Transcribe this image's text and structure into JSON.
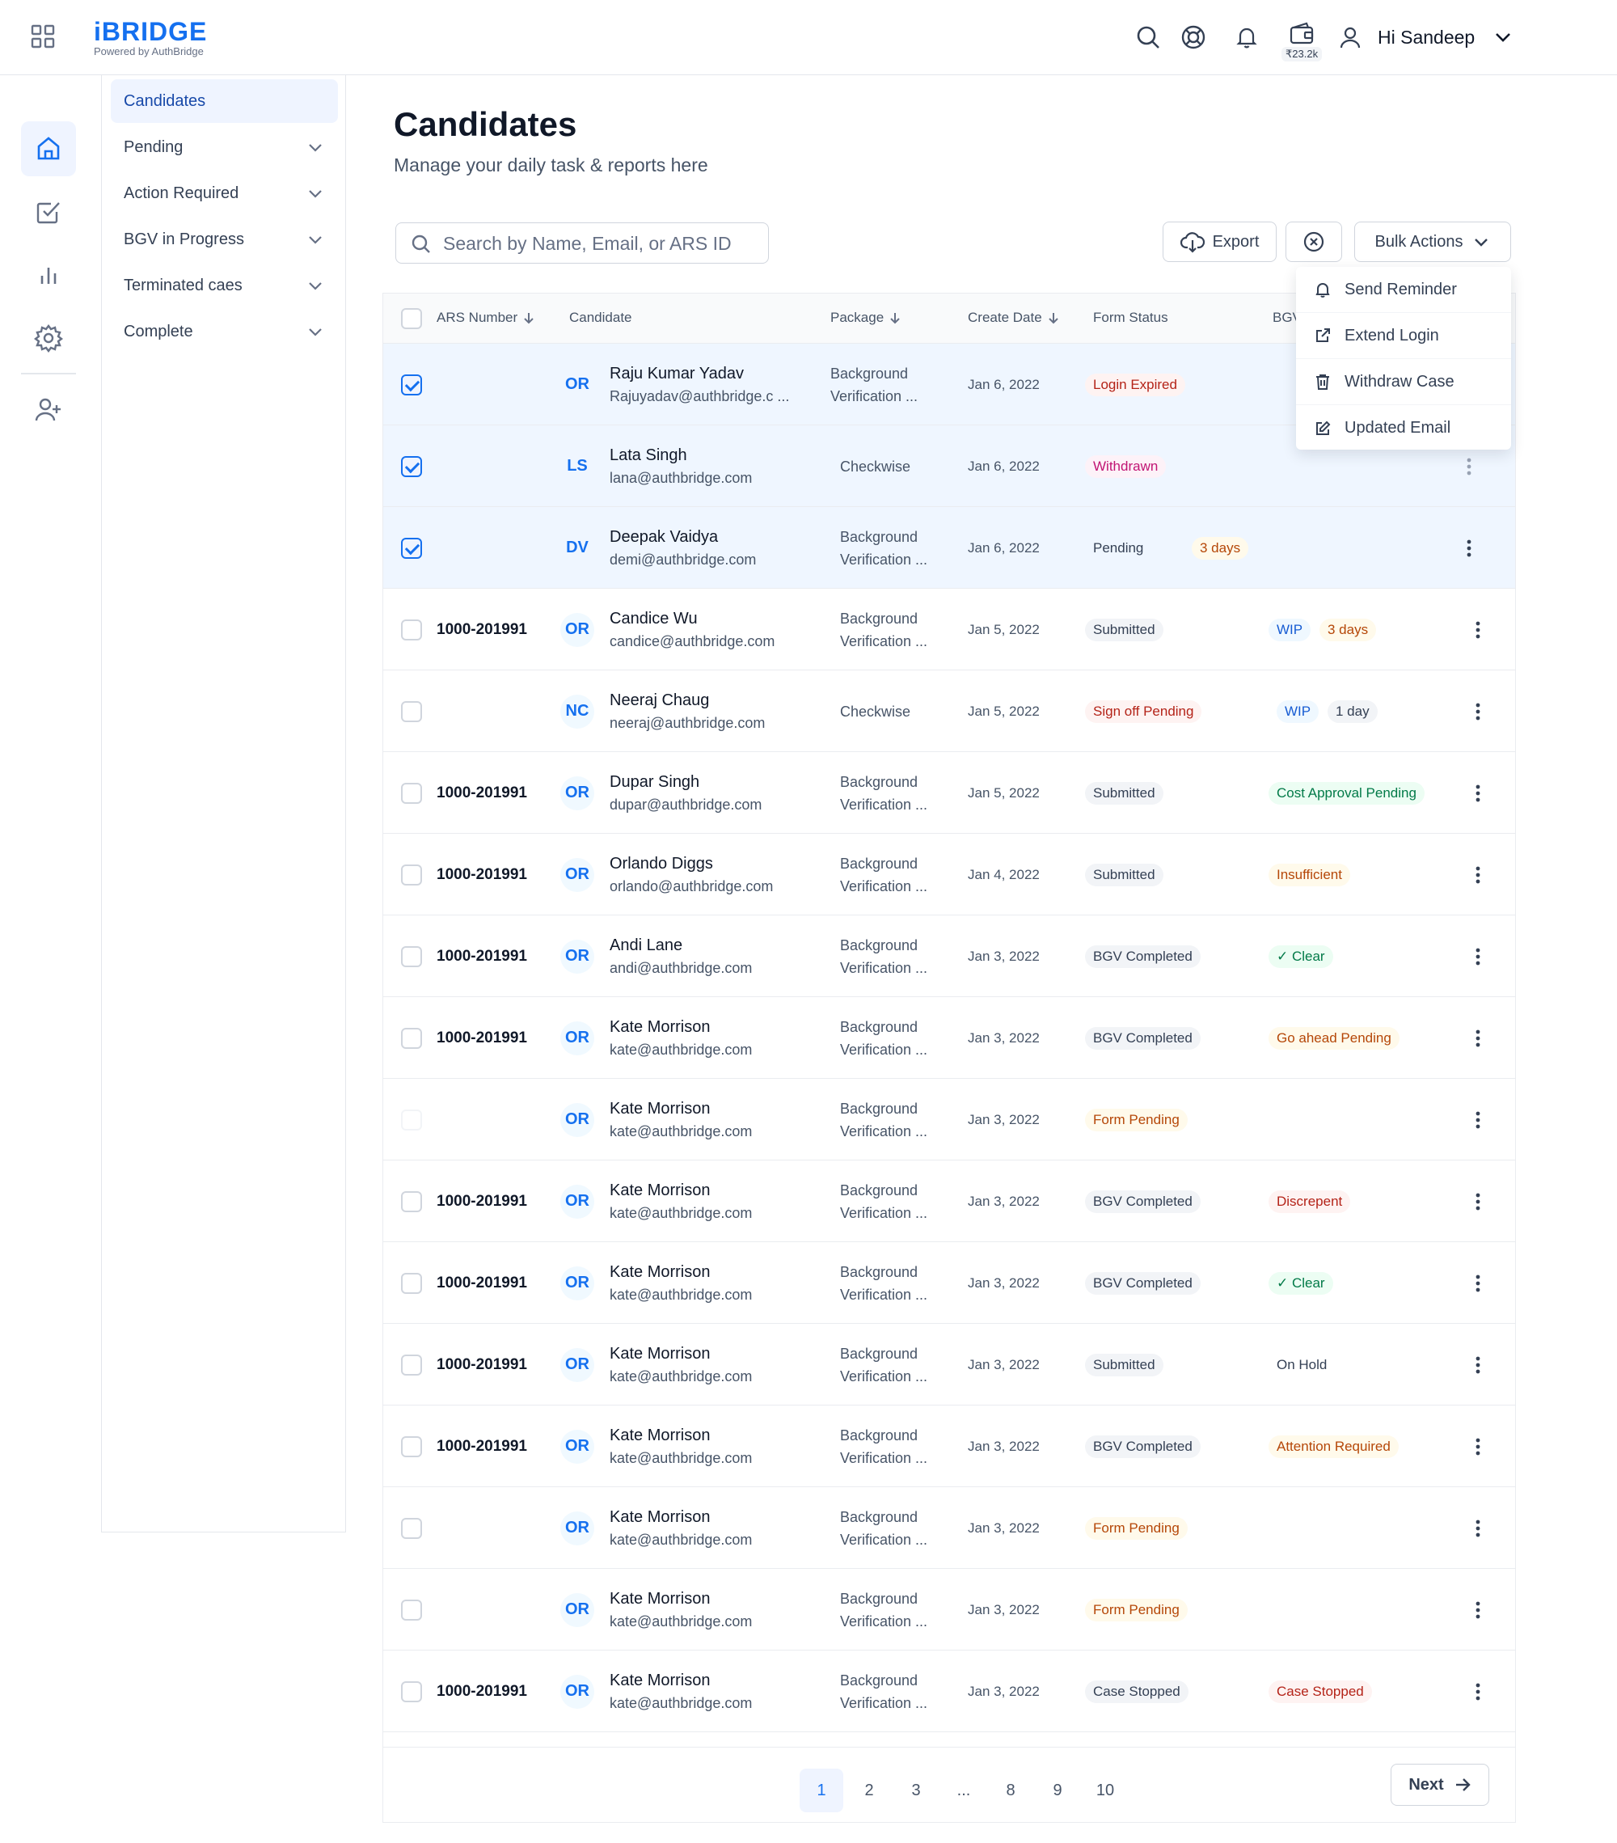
{
  "app": {
    "brand": "iBRIDGE",
    "brand_sub": "Powered by AuthBridge",
    "wallet_balance": "₹23.2k",
    "greeting": "Hi Sandeep"
  },
  "subnav": {
    "items": [
      {
        "label": "Candidates",
        "active": true,
        "expandable": false
      },
      {
        "label": "Pending",
        "active": false,
        "expandable": true
      },
      {
        "label": "Action Required",
        "active": false,
        "expandable": true
      },
      {
        "label": "BGV in Progress",
        "active": false,
        "expandable": true
      },
      {
        "label": "Terminated caes",
        "active": false,
        "expandable": true
      },
      {
        "label": "Complete",
        "active": false,
        "expandable": true
      }
    ]
  },
  "header": {
    "title": "Candidates",
    "subtitle": "Manage your daily task & reports here"
  },
  "toolbar": {
    "search_placeholder": "Search by Name, Email, or ARS ID",
    "export_label": "Export",
    "bulk_label": "Bulk Actions"
  },
  "bulk_menu": {
    "items": [
      {
        "label": "Send Reminder",
        "icon": "bell-icon"
      },
      {
        "label": "Extend Login",
        "icon": "external-link-icon"
      },
      {
        "label": "Withdraw Case",
        "icon": "trash-icon"
      },
      {
        "label": "Updated Email",
        "icon": "edit-icon"
      }
    ]
  },
  "table": {
    "columns": {
      "ars": "ARS Number",
      "candidate": "Candidate",
      "package": "Package",
      "create_date": "Create Date",
      "form_status": "Form Status",
      "bgv": "BGV"
    },
    "rows": [
      {
        "checked": true,
        "ars": "",
        "initials": "OR",
        "name": "Raju Kumar Yadav",
        "email": "Rajuyadav@authbridge.c ...",
        "package": [
          "Background",
          "Verification ..."
        ],
        "date": "Jan 6, 2022",
        "form": "Login Expired",
        "form_tone": "red",
        "form_extra": "",
        "bgv": "",
        "bgv_tone": "",
        "bgv_extra": ""
      },
      {
        "checked": true,
        "ars": "",
        "initials": "LS",
        "name": "Lata Singh",
        "email": "lana@authbridge.com",
        "package": [
          "Checkwise"
        ],
        "date": "Jan 6, 2022",
        "form": "Withdrawn",
        "form_tone": "pink",
        "form_extra": "",
        "bgv": "",
        "bgv_tone": "",
        "bgv_extra": ""
      },
      {
        "checked": true,
        "ars": "",
        "initials": "DV",
        "name": "Deepak Vaidya",
        "email": "demi@authbridge.com",
        "package": [
          "Background",
          "Verification ..."
        ],
        "date": "Jan 6, 2022",
        "form": "Pending",
        "form_tone": "plain",
        "form_extra": "3 days",
        "bgv": "",
        "bgv_tone": "",
        "bgv_extra": ""
      },
      {
        "checked": false,
        "ars": "1000-201991",
        "initials": "OR",
        "name": "Candice Wu",
        "email": "candice@authbridge.com",
        "package": [
          "Background",
          "Verification ..."
        ],
        "date": "Jan 5, 2022",
        "form": "Submitted",
        "form_tone": "gray",
        "form_extra": "",
        "bgv": "WIP",
        "bgv_tone": "blue",
        "bgv_extra": "3 days"
      },
      {
        "checked": false,
        "ars": "",
        "initials": "NC",
        "name": "Neeraj Chaug",
        "email": "neeraj@authbridge.com",
        "package": [
          "Checkwise"
        ],
        "date": "Jan 5, 2022",
        "form": "Sign off Pending",
        "form_tone": "red",
        "form_extra": "",
        "bgv": "WIP",
        "bgv_tone": "blue",
        "bgv_extra": "1 day"
      },
      {
        "checked": false,
        "ars": "1000-201991",
        "initials": "OR",
        "name": "Dupar Singh",
        "email": "dupar@authbridge.com",
        "package": [
          "Background",
          "Verification ..."
        ],
        "date": "Jan 5, 2022",
        "form": "Submitted",
        "form_tone": "gray",
        "form_extra": "",
        "bgv": "Cost Approval Pending",
        "bgv_tone": "green",
        "bgv_extra": ""
      },
      {
        "checked": false,
        "ars": "1000-201991",
        "initials": "OR",
        "name": "Orlando Diggs",
        "email": "orlando@authbridge.com",
        "package": [
          "Background",
          "Verification ..."
        ],
        "date": "Jan 4, 2022",
        "form": "Submitted",
        "form_tone": "gray",
        "form_extra": "",
        "bgv": "Insufficient",
        "bgv_tone": "orange",
        "bgv_extra": ""
      },
      {
        "checked": false,
        "ars": "1000-201991",
        "initials": "OR",
        "name": "Andi Lane",
        "email": "andi@authbridge.com",
        "package": [
          "Background",
          "Verification ..."
        ],
        "date": "Jan 3, 2022",
        "form": "BGV Completed",
        "form_tone": "gray",
        "form_extra": "",
        "bgv": "✓ Clear",
        "bgv_tone": "green",
        "bgv_extra": ""
      },
      {
        "checked": false,
        "ars": "1000-201991",
        "initials": "OR",
        "name": "Kate Morrison",
        "email": "kate@authbridge.com",
        "package": [
          "Background",
          "Verification ..."
        ],
        "date": "Jan 3, 2022",
        "form": "BGV Completed",
        "form_tone": "gray",
        "form_extra": "",
        "bgv": "Go ahead Pending",
        "bgv_tone": "orange",
        "bgv_extra": ""
      },
      {
        "checked": false,
        "disabled": true,
        "ars": "",
        "initials": "OR",
        "name": "Kate Morrison",
        "email": "kate@authbridge.com",
        "package": [
          "Background",
          "Verification ..."
        ],
        "date": "Jan 3, 2022",
        "form": "Form Pending",
        "form_tone": "orange",
        "form_extra": "",
        "bgv": "",
        "bgv_tone": "",
        "bgv_extra": ""
      },
      {
        "checked": false,
        "ars": "1000-201991",
        "initials": "OR",
        "name": "Kate Morrison",
        "email": "kate@authbridge.com",
        "package": [
          "Background",
          "Verification ..."
        ],
        "date": "Jan 3, 2022",
        "form": "BGV Completed",
        "form_tone": "gray",
        "form_extra": "",
        "bgv": "Discrepent",
        "bgv_tone": "red",
        "bgv_extra": ""
      },
      {
        "checked": false,
        "ars": "1000-201991",
        "initials": "OR",
        "name": "Kate Morrison",
        "email": "kate@authbridge.com",
        "package": [
          "Background",
          "Verification ..."
        ],
        "date": "Jan 3, 2022",
        "form": "BGV Completed",
        "form_tone": "gray",
        "form_extra": "",
        "bgv": "✓ Clear",
        "bgv_tone": "green",
        "bgv_extra": ""
      },
      {
        "checked": false,
        "ars": "1000-201991",
        "initials": "OR",
        "name": "Kate Morrison",
        "email": "kate@authbridge.com",
        "package": [
          "Background",
          "Verification ..."
        ],
        "date": "Jan 3, 2022",
        "form": "Submitted",
        "form_tone": "gray",
        "form_extra": "",
        "bgv": "On Hold",
        "bgv_tone": "plain",
        "bgv_extra": ""
      },
      {
        "checked": false,
        "ars": "1000-201991",
        "initials": "OR",
        "name": "Kate Morrison",
        "email": "kate@authbridge.com",
        "package": [
          "Background",
          "Verification ..."
        ],
        "date": "Jan 3, 2022",
        "form": "BGV Completed",
        "form_tone": "gray",
        "form_extra": "",
        "bgv": "Attention Required",
        "bgv_tone": "orange",
        "bgv_extra": ""
      },
      {
        "checked": false,
        "ars": "",
        "initials": "OR",
        "name": "Kate Morrison",
        "email": "kate@authbridge.com",
        "package": [
          "Background",
          "Verification ..."
        ],
        "date": "Jan 3, 2022",
        "form": "Form Pending",
        "form_tone": "orange",
        "form_extra": "",
        "bgv": "",
        "bgv_tone": "",
        "bgv_extra": ""
      },
      {
        "checked": false,
        "ars": "",
        "initials": "OR",
        "name": "Kate Morrison",
        "email": "kate@authbridge.com",
        "package": [
          "Background",
          "Verification ..."
        ],
        "date": "Jan 3, 2022",
        "form": "Form Pending",
        "form_tone": "orange",
        "form_extra": "",
        "bgv": "",
        "bgv_tone": "",
        "bgv_extra": ""
      },
      {
        "checked": false,
        "ars": "1000-201991",
        "initials": "OR",
        "name": "Kate Morrison",
        "email": "kate@authbridge.com",
        "package": [
          "Background",
          "Verification ..."
        ],
        "date": "Jan 3, 2022",
        "form": "Case Stopped",
        "form_tone": "gray",
        "form_extra": "",
        "bgv": "Case Stopped",
        "bgv_tone": "red",
        "bgv_extra": ""
      }
    ]
  },
  "pagination": {
    "pages": [
      "1",
      "2",
      "3",
      "...",
      "8",
      "9",
      "10"
    ],
    "current": "1",
    "next_label": "Next"
  },
  "tones": {
    "red": {
      "bg": "#fef3f2",
      "fg": "#b42318"
    },
    "pink": {
      "bg": "#fdf2f8",
      "fg": "#c11574"
    },
    "orange": {
      "bg": "#fffaeb",
      "fg": "#b54708"
    },
    "gray": {
      "bg": "#f2f4f7",
      "fg": "#344054"
    },
    "green": {
      "bg": "#ecfdf3",
      "fg": "#027a48"
    },
    "blue": {
      "bg": "#eff8ff",
      "fg": "#175cd3"
    },
    "plain": {
      "bg": "transparent",
      "fg": "#344054"
    }
  }
}
